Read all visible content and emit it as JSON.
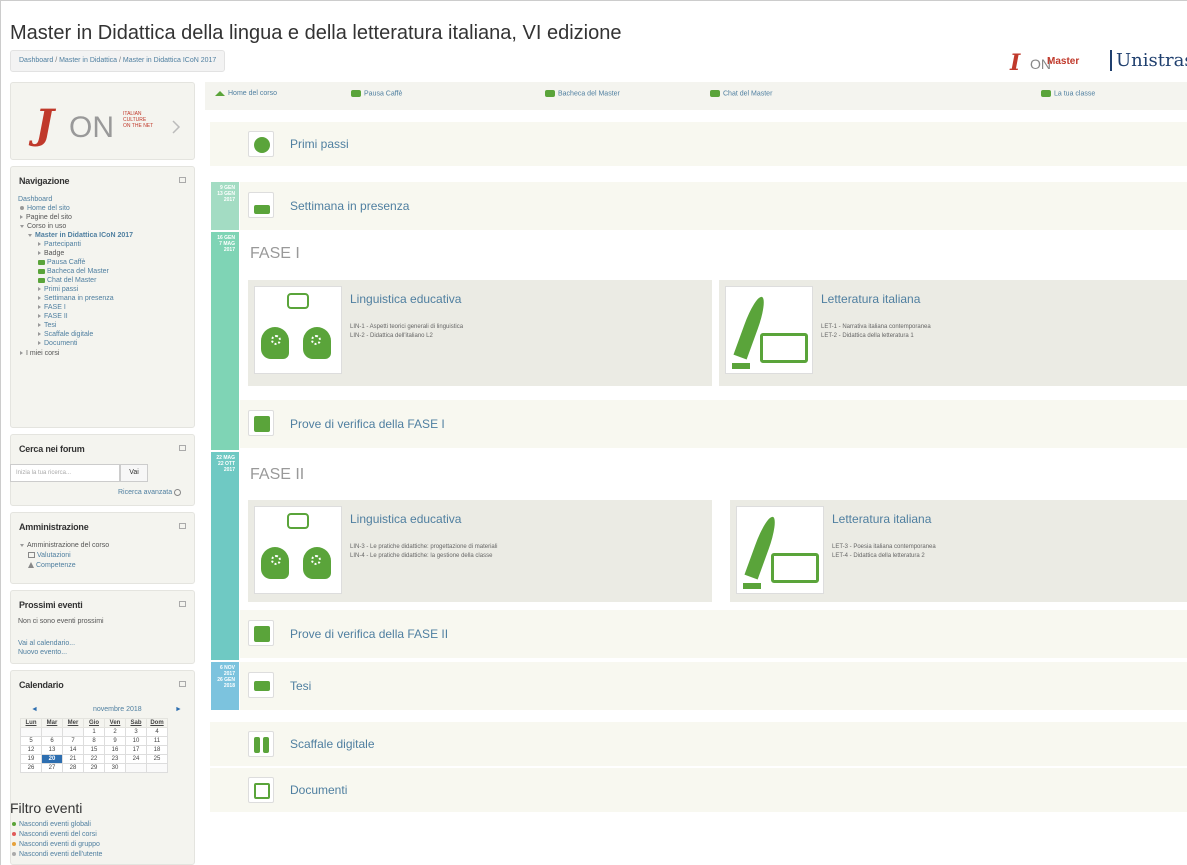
{
  "header": {
    "title": "Master in Didattica della lingua e della letteratura italiana, VI edizione",
    "breadcrumb": [
      "Dashboard",
      "Master in Didattica",
      "Master in Didattica ICoN 2017"
    ],
    "brand_icon": "ICoN",
    "brand_master": "Master",
    "brand_uni": "Unistrasi"
  },
  "topnav": [
    "Home del corso",
    "Pausa Caffè",
    "Bacheca del Master",
    "Chat del Master",
    "La tua classe"
  ],
  "sidebar": {
    "logo": {
      "word": "ICoN",
      "sub1": "ITALIAN",
      "sub2": "CULTURE",
      "sub3": "ON THE NET"
    },
    "nav_title": "Navigazione",
    "nav_items": [
      "Dashboard",
      "Home del sito",
      "Pagine del sito",
      "Corso in uso",
      "Master in Didattica ICoN 2017",
      "Partecipanti",
      "Badge",
      "Pausa Caffè",
      "Bacheca del Master",
      "Chat del Master",
      "Primi passi",
      "Settimana in presenza",
      "FASE I",
      "FASE II",
      "Tesi",
      "Scaffale digitale",
      "Documenti",
      "I miei corsi"
    ],
    "search_title": "Cerca nei forum",
    "search_placeholder": "Inizia la tua ricerca...",
    "search_button": "Vai",
    "search_adv": "Ricerca avanzata",
    "admin_title": "Amministrazione",
    "admin_items": [
      "Amministrazione del corso",
      "Valutazioni",
      "Competenze"
    ],
    "events_title": "Prossimi eventi",
    "events_none": "Non ci sono eventi prossimi",
    "events_links": [
      "Vai al calendario...",
      "Nuovo evento..."
    ],
    "cal_title": "Calendario",
    "cal_month": "novembre 2018",
    "cal_days": [
      "Lun",
      "Mar",
      "Mer",
      "Gio",
      "Ven",
      "Sab",
      "Dom"
    ],
    "cal_rows": [
      [
        "",
        "",
        "",
        "1",
        "2",
        "3",
        "4"
      ],
      [
        "5",
        "6",
        "7",
        "8",
        "9",
        "10",
        "11"
      ],
      [
        "12",
        "13",
        "14",
        "15",
        "16",
        "17",
        "18"
      ],
      [
        "19",
        "20",
        "21",
        "22",
        "23",
        "24",
        "25"
      ],
      [
        "26",
        "27",
        "28",
        "29",
        "30",
        "",
        ""
      ]
    ],
    "filter_title": "Filtro eventi",
    "filter_items": [
      "Nascondi eventi globali",
      "Nascondi eventi del corsi",
      "Nascondi eventi di gruppo",
      "Nascondi eventi dell'utente"
    ]
  },
  "main": {
    "primi_passi": "Primi passi",
    "settimana": "Settimana in presenza",
    "fase1": "FASE I",
    "fase2": "FASE II",
    "prove1": "Prove di verifica della FASE I",
    "prove2": "Prove di verifica della FASE II",
    "tesi": "Tesi",
    "scaffale": "Scaffale digitale",
    "documenti": "Documenti",
    "timeline": [
      [
        "9 GEN",
        "13 GEN",
        "2017"
      ],
      [
        "16 GEN",
        "7 MAG",
        "2017"
      ],
      [
        "22 MAG",
        "22 OTT",
        "2017"
      ],
      [
        "6 NOV",
        "2017",
        "26 GEN",
        "2018"
      ]
    ],
    "f1_ling": {
      "title": "Linguistica educativa",
      "l1": "LIN-1 - Aspetti teorici generali di linguistica",
      "l2": "LIN-2 - Didattica dell'italiano L2"
    },
    "f1_lett": {
      "title": "Letteratura italiana",
      "l1": "LET-1 - Narrativa italiana contemporanea",
      "l2": "LET-2 - Didattica della letteratura 1"
    },
    "f2_ling": {
      "title": "Linguistica educativa",
      "l1": "LIN-3 - Le pratiche didattiche: progettazione di materiali",
      "l2": "LIN-4 - Le pratiche didattiche: la gestione della classe"
    },
    "f2_lett": {
      "title": "Letteratura italiana",
      "l1": "LET-3 - Poesia italiana contemporanea",
      "l2": "LET-4 - Didattica della letteratura 2"
    }
  }
}
